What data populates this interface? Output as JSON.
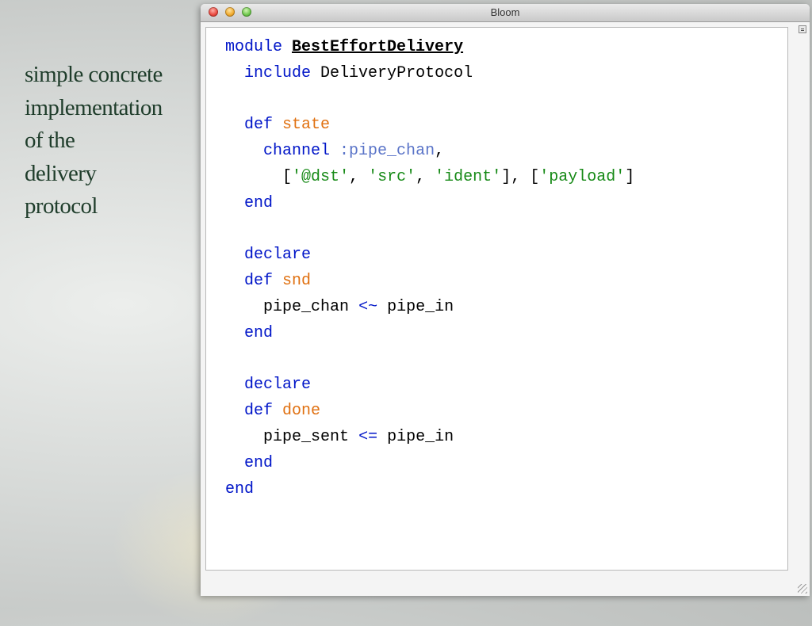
{
  "slide": {
    "caption": "simple concrete\nimplementation\nof the\ndelivery\nprotocol"
  },
  "window": {
    "title": "Bloom",
    "traffic_lights": [
      "close-button",
      "minimize-button",
      "zoom-button"
    ]
  },
  "code": {
    "module_kw": "module",
    "module_name": "BestEffortDelivery",
    "include_kw": "include",
    "include_name": "DeliveryProtocol",
    "def_kw": "def",
    "end_kw": "end",
    "declare_kw": "declare",
    "state_name": "state",
    "channel_kw": "channel",
    "pipe_chan_symbol": ":pipe_chan",
    "comma": ",",
    "open_bracket": "[",
    "close_bracket": "]",
    "field_sep": ", ",
    "quote": "'",
    "key_dst": "@dst",
    "key_src": "src",
    "key_ident": "ident",
    "val_payload": "payload",
    "snd_name": "snd",
    "snd_lhs": "pipe_chan",
    "async_op": "<~",
    "snd_rhs": "pipe_in",
    "done_name": "done",
    "done_lhs": "pipe_sent",
    "merge_op": "<=",
    "done_rhs": "pipe_in"
  },
  "colors": {
    "keyword": "#0015c8",
    "method_name": "#e07010",
    "symbol": "#5a74c8",
    "string": "#178a17",
    "caption_text": "#1f3d2b"
  }
}
